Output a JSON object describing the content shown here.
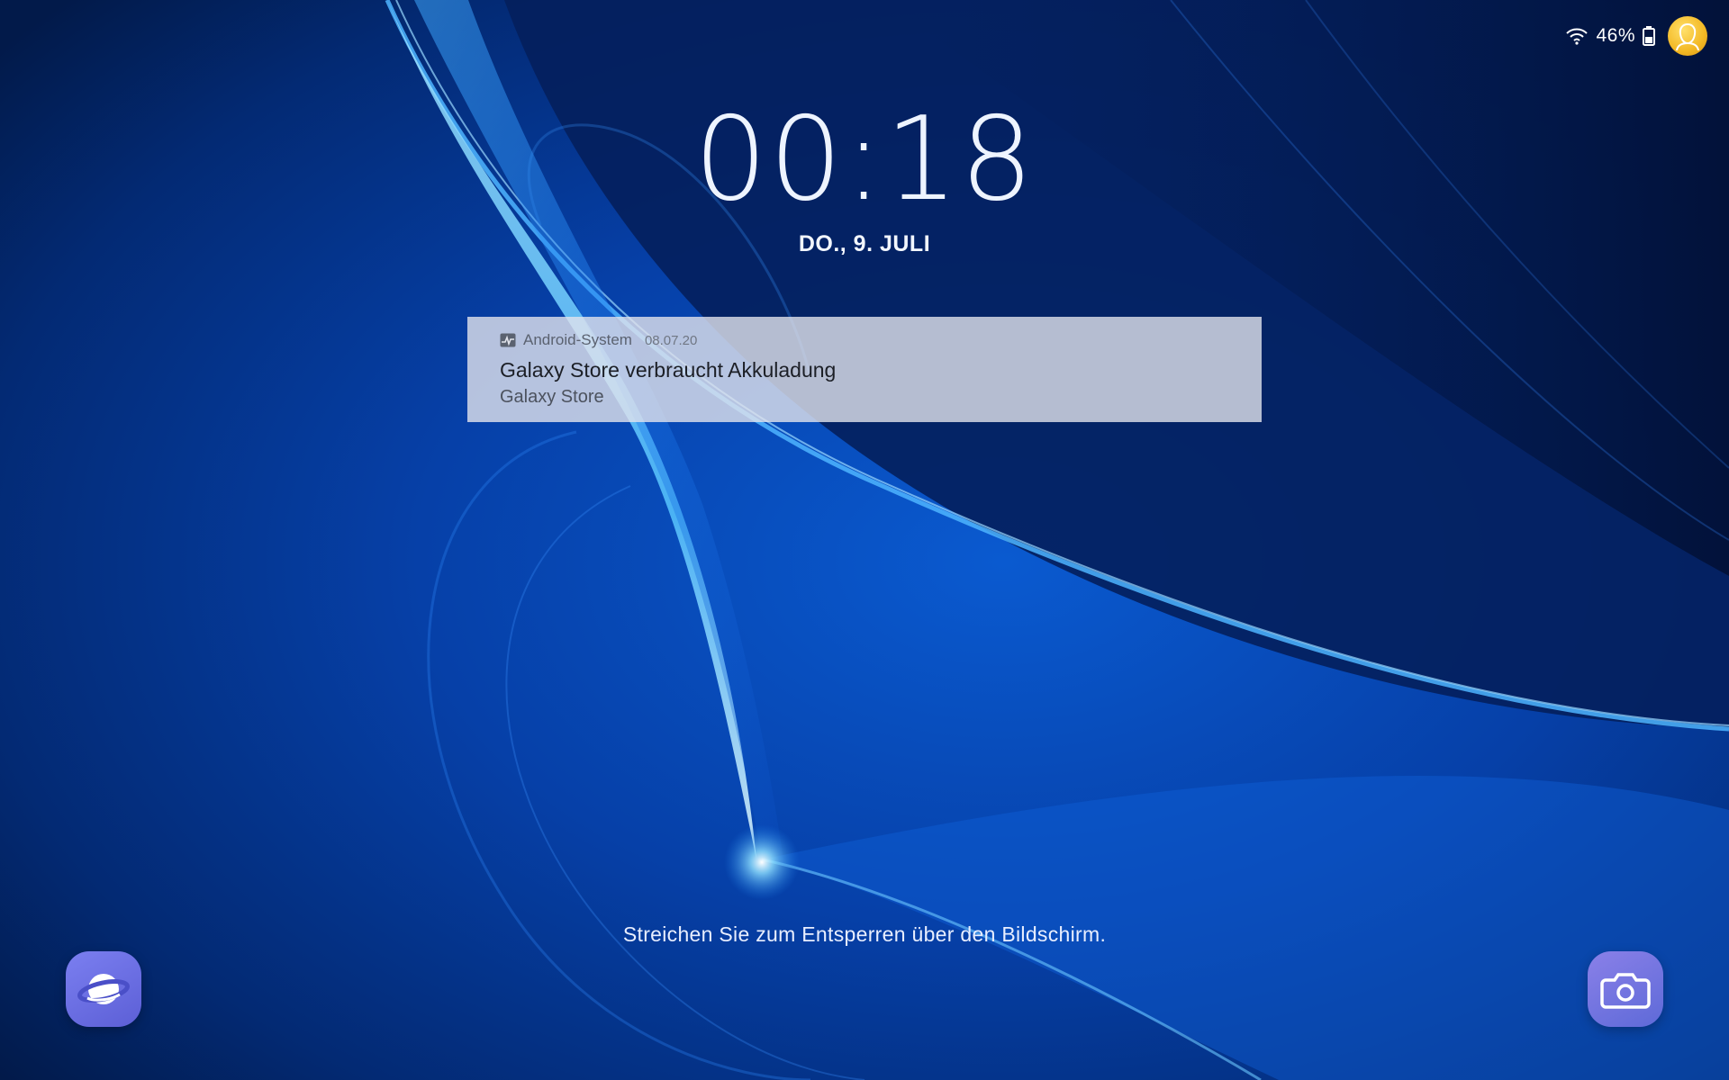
{
  "status_bar": {
    "battery_percent": "46%",
    "wifi_icon": "wifi-icon",
    "battery_icon": "battery-icon",
    "avatar_icon": "user-avatar-icon"
  },
  "lockscreen": {
    "time": "00:18",
    "date": "DO., 9. JULI",
    "unlock_hint": "Streichen Sie zum Entsperren über den Bildschirm."
  },
  "notification": {
    "app_name": "Android-System",
    "timestamp": "08.07.20",
    "title": "Galaxy Store verbraucht Akkuladung",
    "body": "Galaxy Store",
    "app_icon": "activity-chart-icon"
  },
  "shortcuts": {
    "left": "internet-browser-icon",
    "right": "camera-icon"
  },
  "colors": {
    "wallpaper_base": "#021a52",
    "wallpaper_accent": "#2a9df4",
    "notification_bg": "#e2e4ec",
    "shortcut_purple": "#6a6ee6"
  }
}
